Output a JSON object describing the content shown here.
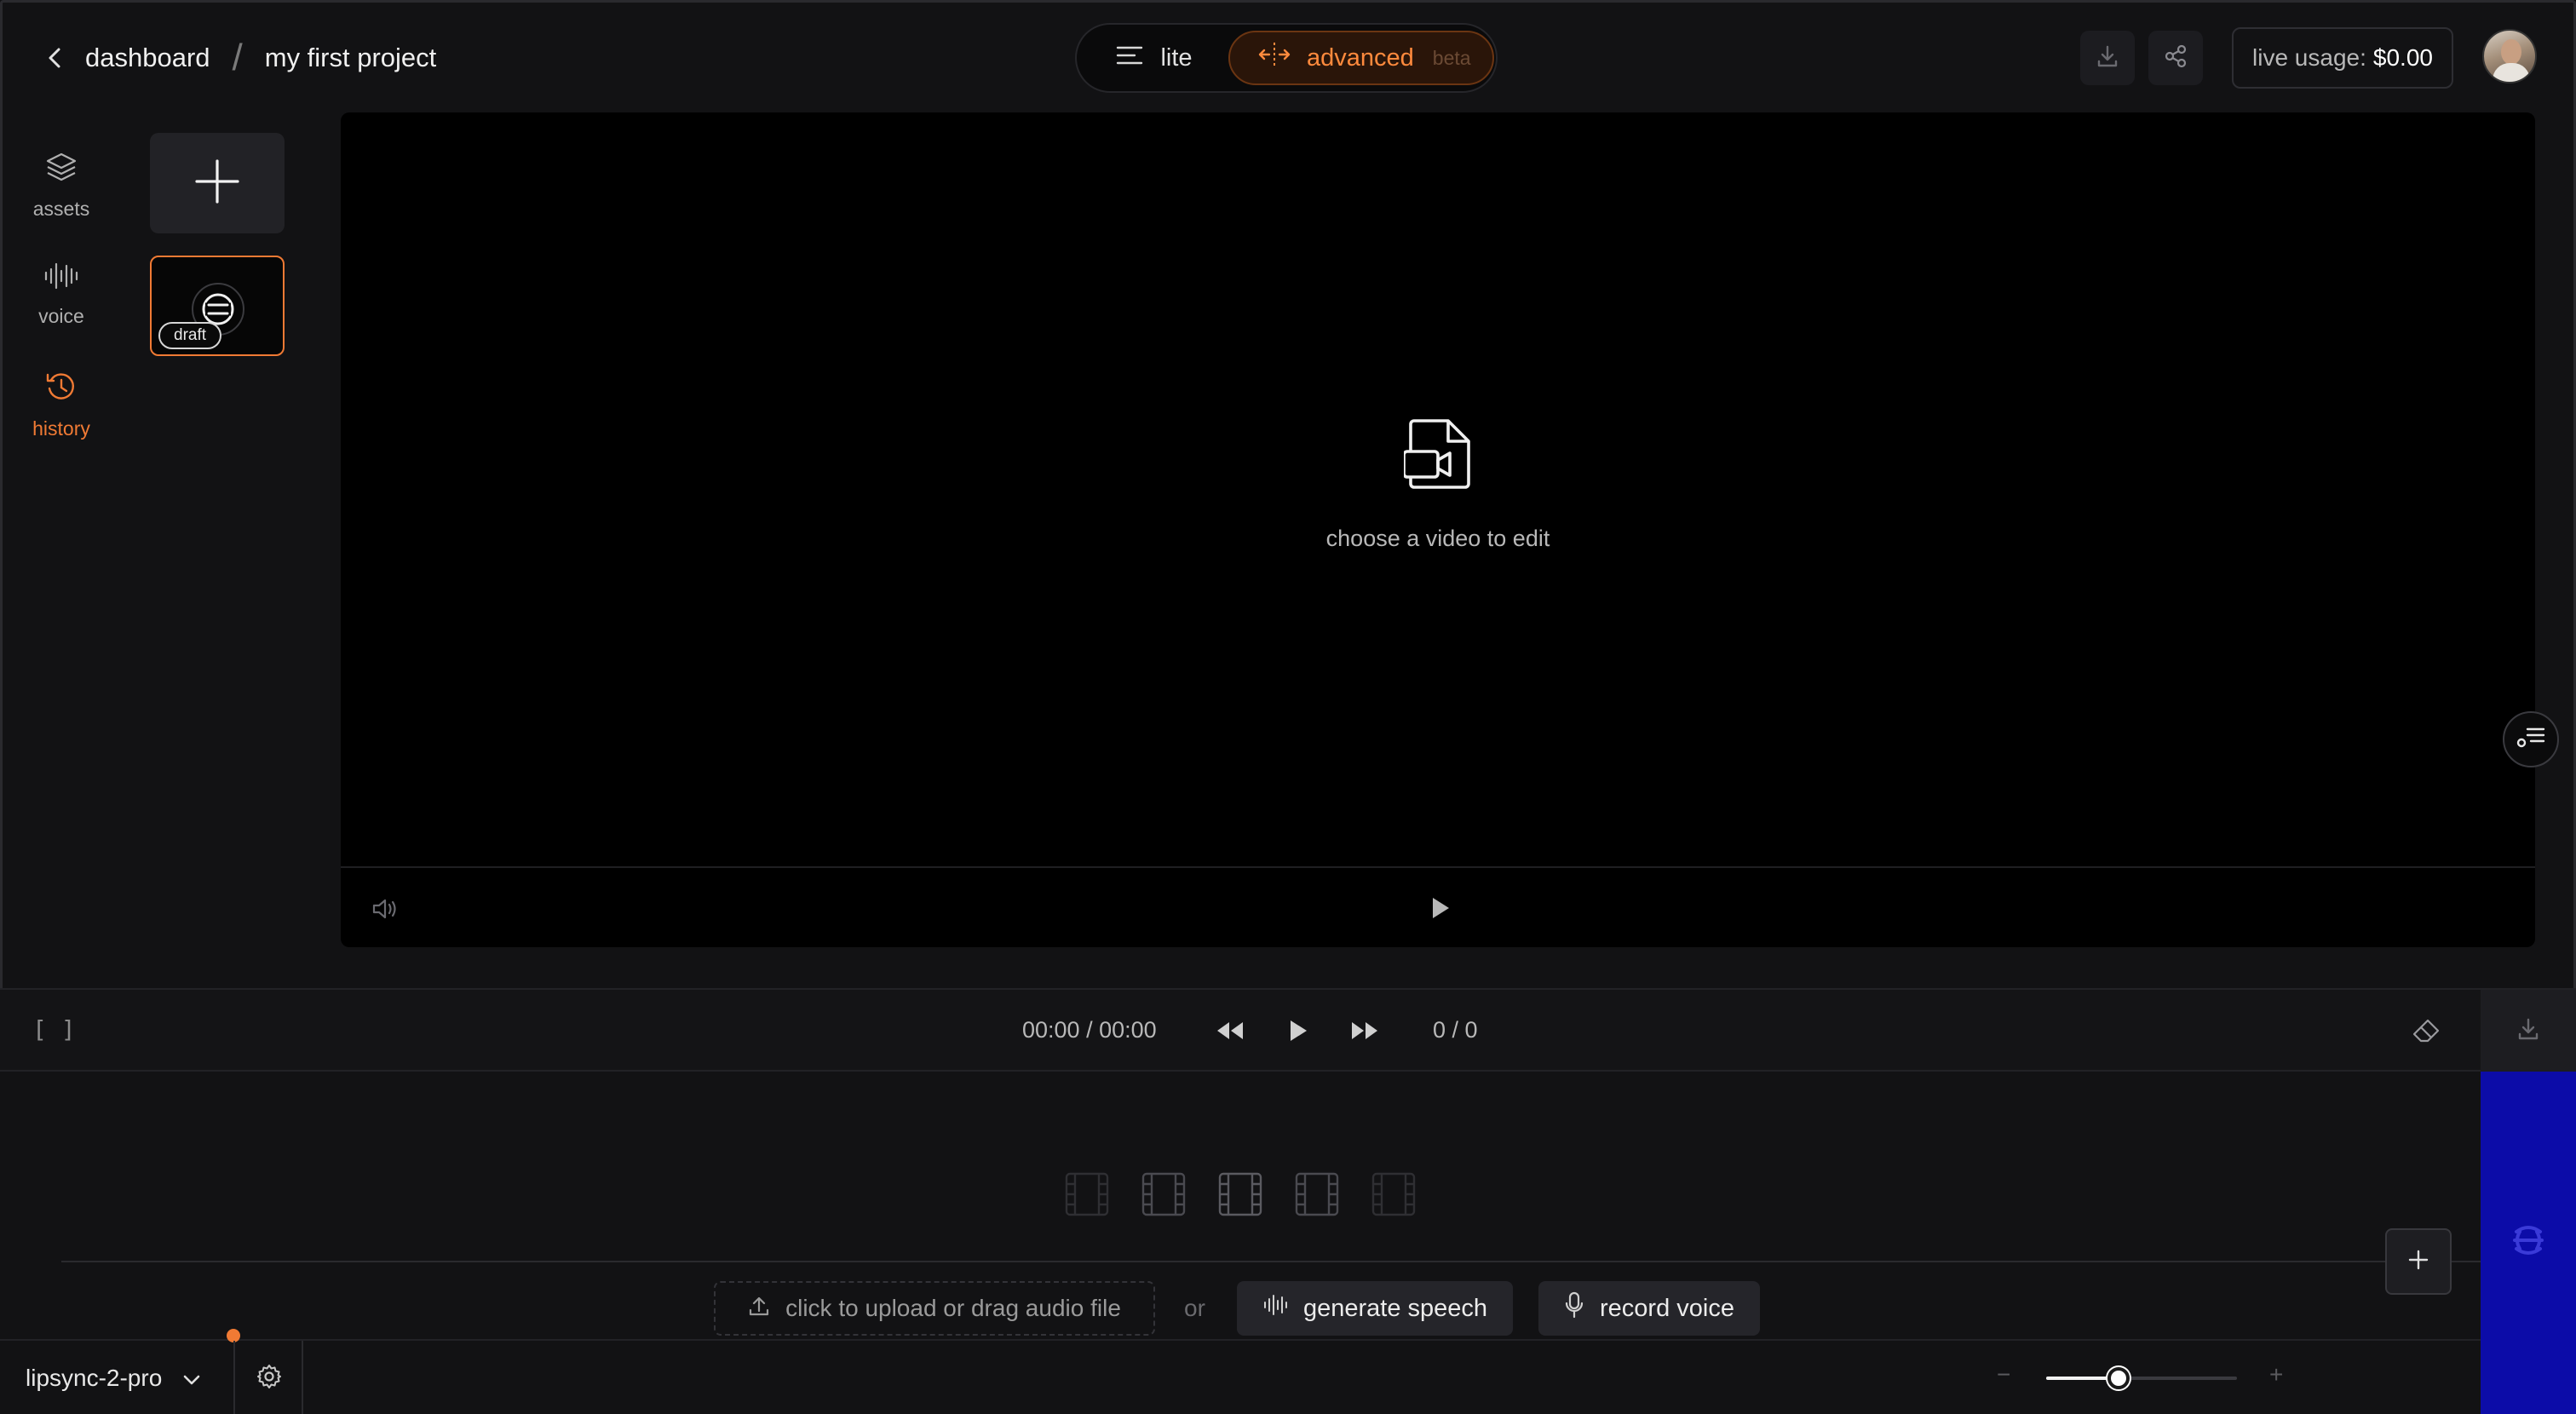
{
  "header": {
    "breadcrumb_root": "dashboard",
    "breadcrumb_sep": "/",
    "project_name": "my first project",
    "mode_lite": "lite",
    "mode_advanced": "advanced",
    "mode_advanced_tag": "beta",
    "usage_label": "live usage:",
    "usage_amount": "$0.00"
  },
  "sidebar": {
    "items": [
      {
        "label": "assets",
        "icon": "layers-icon"
      },
      {
        "label": "voice",
        "icon": "waveform-icon"
      },
      {
        "label": "history",
        "icon": "history-icon",
        "active": true
      }
    ]
  },
  "assets": {
    "draft_badge": "draft"
  },
  "player": {
    "empty_message": "choose a video to edit"
  },
  "timeline": {
    "bracket": "[ ]",
    "timecode": "00:00 / 00:00",
    "frame_counter": "0 / 0"
  },
  "audio": {
    "upload_label": "click to upload or drag audio file",
    "or_label": "or",
    "generate_label": "generate speech",
    "record_label": "record voice"
  },
  "footer": {
    "model_name": "lipsync-2-pro",
    "zoom_level": 0.38
  },
  "colors": {
    "accent": "#f07a34",
    "rail_blue": "#0c0ca8",
    "background": "#121214"
  }
}
